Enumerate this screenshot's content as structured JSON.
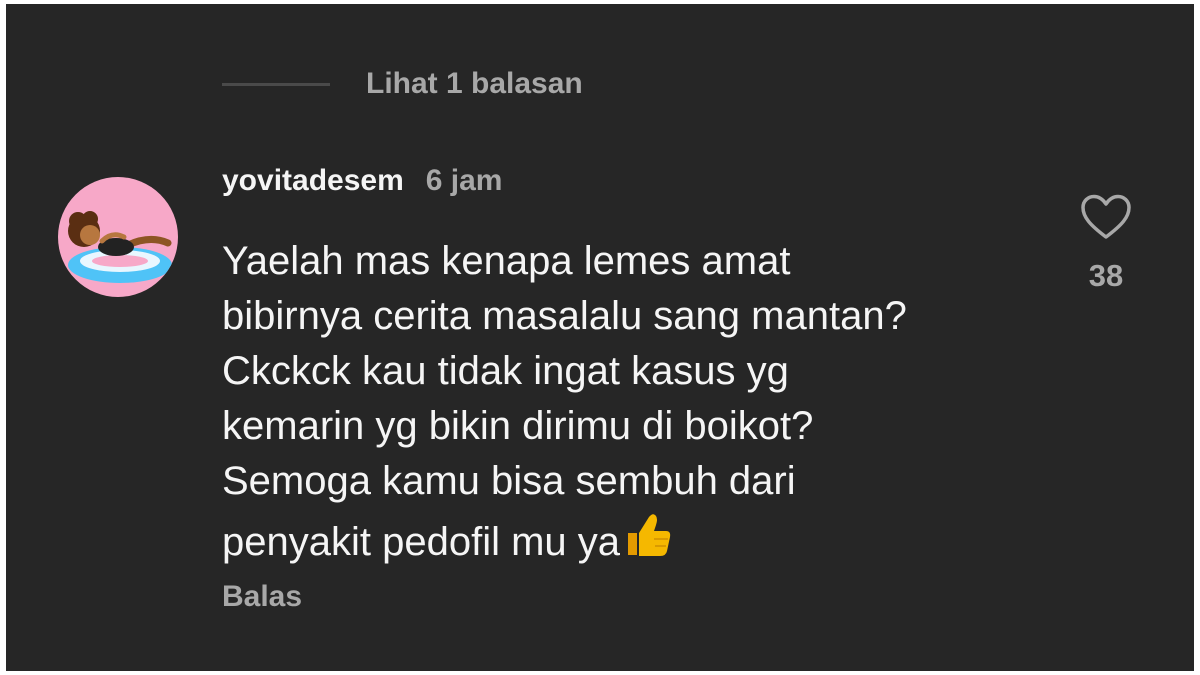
{
  "replies_toggle": {
    "label": "Lihat 1 balasan"
  },
  "comment": {
    "username": "yovitadesem",
    "time": "6 jam",
    "text": "Yaelah mas kenapa lemes amat\nbibirnya cerita masalalu sang mantan?\nCkckck kau tidak ingat kasus yg\nkemarin yg bikin dirimu di boikot?\nSemoga kamu bisa sembuh dari\npenyakit pedofil mu ya",
    "trailing_emoji": "thumbs-up-icon",
    "reply_label": "Balas",
    "like_count": "38"
  },
  "colors": {
    "background": "#262626",
    "primary_text": "#f5f5f5",
    "secondary_text": "#a8a8a8",
    "avatar_bg": "#f7a8c8",
    "emoji": "#f5b800"
  }
}
